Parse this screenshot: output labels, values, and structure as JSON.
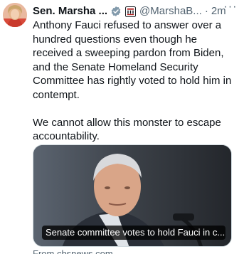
{
  "tweet": {
    "display_name": "Sen. Marsha ...",
    "handle": "@MarshaB...",
    "separator": "·",
    "time": "2m",
    "more_glyph": "···",
    "body_paragraphs": [
      "Anthony Fauci refused to answer over a hundred questions even though he received a sweeping pardon from Biden, and the Senate Homeland Security Committee has rightly voted to hold him in contempt.",
      "We cannot allow this monster to escape accountability."
    ],
    "card": {
      "title": "Senate committee votes to hold Fauci in c...",
      "source": "From cbsnews.com"
    }
  },
  "colors": {
    "text_primary": "#0f1419",
    "text_secondary": "#536471",
    "verified_badge": "#829aab",
    "card_border": "#cfd9de"
  },
  "icons": {
    "verified": "verified-badge-icon",
    "affiliate": "senate-affiliate-icon",
    "more": "more-icon"
  }
}
